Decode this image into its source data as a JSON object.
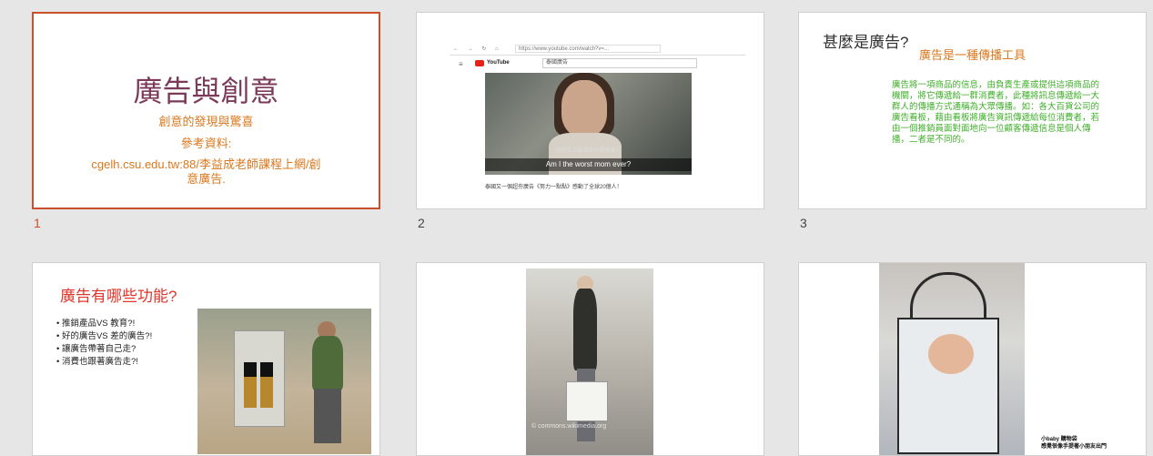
{
  "slides": [
    {
      "number": "1",
      "title": "廣告與創意",
      "subtitle": "創意的發現與驚喜",
      "reference_label": "參考資料:",
      "reference_link": "cgelh.csu.edu.tw:88/李益成老師課程上網/創意廣告."
    },
    {
      "number": "2",
      "browser_arrows": "← → ↻ ⌂",
      "browser_url": "https://www.youtube.com/watch?v=...",
      "youtube_label": "YouTube",
      "search_text": "泰國廣告",
      "subtitle_small": "我是史上最差勁的媽媽嗎？",
      "subtitle_main": "Am I the worst mom ever?",
      "caption": "泰國又一個超夯廣告《努力一點點》感動了全球20億人！"
    },
    {
      "number": "3",
      "title": "甚麼是廣告?",
      "subtitle": "廣告是一種傳播工具",
      "body": "廣告將一項商品的信息，由負責生產或提供這項商品的機關，將它傳遞給一群消費者，此種將訊息傳遞給一大群人的傳播方式通稱為大眾傳播。如：各大百貨公司的廣告看板，藉由看板將廣告資訊傳遞給每位消費者，若由一個推銷員面對面地向一位顧客傳遞信息是個人傳播，二者是不同的。"
    },
    {
      "number": "",
      "title": "廣告有哪些功能?",
      "bullets": [
        "推銷產品VS 教育?!",
        "好的廣告VS 差的廣告?!",
        "讓廣告帶著自己走?",
        "消費也跟著廣告走?!"
      ]
    },
    {
      "number": "",
      "watermark": "© commons.wikimedia.org"
    },
    {
      "number": "",
      "caption_line1": "小baby 購物袋",
      "caption_line2": "感覺很像手提著小朋友出門"
    }
  ]
}
